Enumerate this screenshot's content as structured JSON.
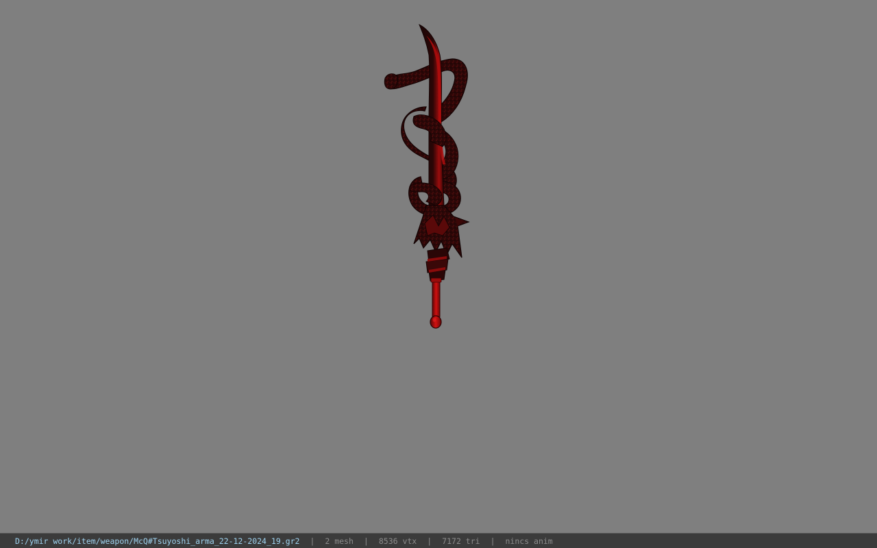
{
  "viewport": {
    "background_color": "#7f7f7f",
    "model": {
      "name": "sword-model",
      "colors": {
        "dark": "#1a0606",
        "mid": "#3a0a0a",
        "red": "#b00d0d",
        "bright_red": "#d01010"
      }
    }
  },
  "statusbar": {
    "file_path": "D:/ymir work/item/weapon/McQ#Tsuyoshi_arma_22-12-2024_19.gr2",
    "separator": "|",
    "mesh_count": "2 mesh",
    "vertex_count": "8536 vtx",
    "triangle_count": "7172 tri",
    "anim_status": "nincs anim",
    "colors": {
      "background": "#3b3b3b",
      "path": "#9fd3f0",
      "text": "#8c8c8c"
    }
  }
}
